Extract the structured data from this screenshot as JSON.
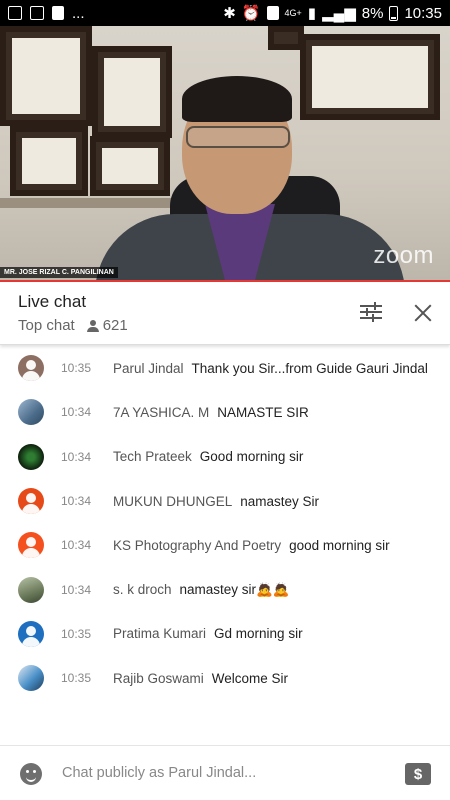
{
  "status_bar": {
    "network": "4G+",
    "battery": "8%",
    "time": "10:35",
    "dots": "..."
  },
  "video": {
    "presenter_name": "MR. JOSE RIZAL C. PANGILINAN",
    "watermark": "zoom"
  },
  "chat_header": {
    "title": "Live chat",
    "mode": "Top chat",
    "viewers": "621"
  },
  "messages": [
    {
      "time": "10:35",
      "author": "Parul Jindal",
      "text": "Thank you Sir...from Guide Gauri Jindal",
      "avatar_color": "#8d6e63"
    },
    {
      "time": "10:34",
      "author": "7A YASHICA. M",
      "text": "NAMASTE SIR",
      "avatar_color": "#5a7b9a"
    },
    {
      "time": "10:34",
      "author": "Tech Prateek",
      "text": "Good morning sir",
      "avatar_color": "#1b3d1b"
    },
    {
      "time": "10:34",
      "author": "MUKUN DHUNGEL",
      "text": "namastey Sir",
      "avatar_color": "#e64a19"
    },
    {
      "time": "10:34",
      "author": "KS Photography And Poetry",
      "text": "good morning sir",
      "avatar_color": "#f4511e"
    },
    {
      "time": "10:34",
      "author": "s. k droch",
      "text": "namastey sir🙇🙇",
      "avatar_color": "#7a8a6a"
    },
    {
      "time": "10:35",
      "author": "Pratima Kumari",
      "text": "Gd morning sir",
      "avatar_color": "#1e6fbf"
    },
    {
      "time": "10:35",
      "author": "Rajib Goswami",
      "text": "Welcome Sir",
      "avatar_color": "#4a90c8"
    }
  ],
  "chat_input": {
    "placeholder": "Chat publicly as Parul Jindal...",
    "superchat_symbol": "$"
  }
}
